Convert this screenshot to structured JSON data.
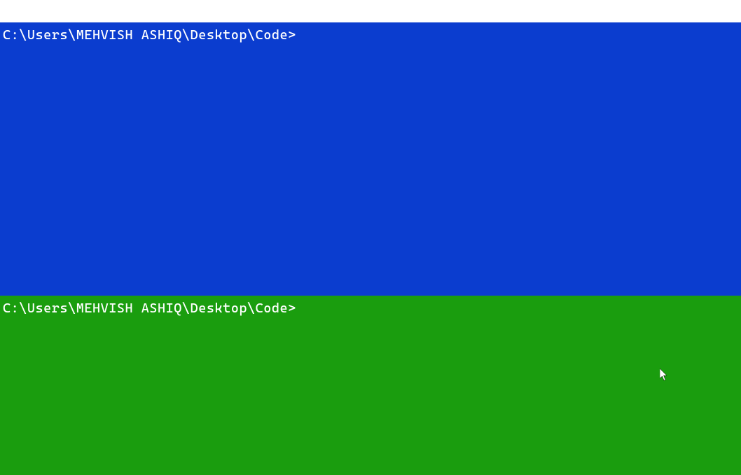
{
  "colors": {
    "top_pane_bg": "#0b3dcf",
    "bottom_pane_bg": "#1a9d0e",
    "text": "#ffffff",
    "title_bar": "#ffffff"
  },
  "panes": {
    "top": {
      "prompt": "C:\\Users\\MEHVISH ASHIQ\\Desktop\\Code>"
    },
    "bottom": {
      "prompt": "C:\\Users\\MEHVISH ASHIQ\\Desktop\\Code>"
    }
  }
}
